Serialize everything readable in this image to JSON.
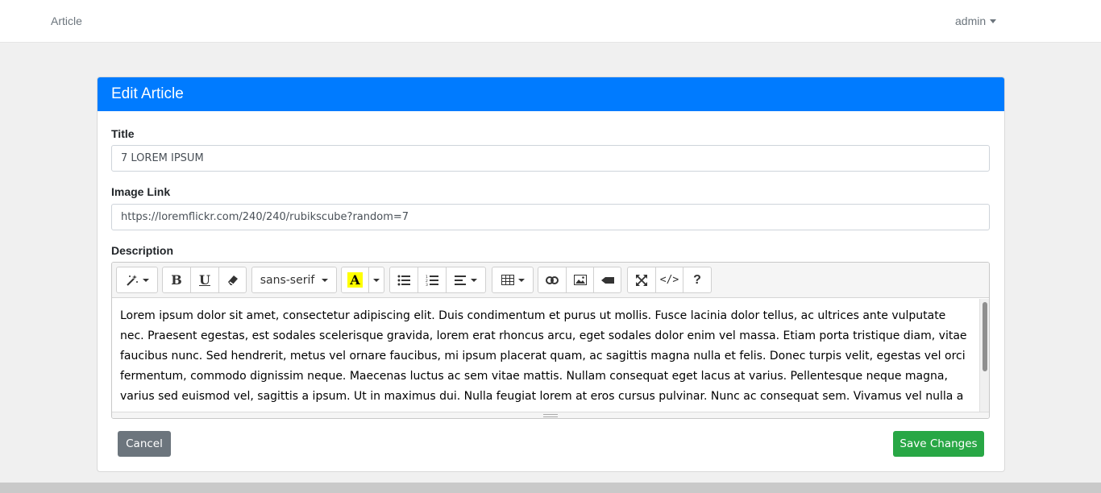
{
  "navbar": {
    "brand": "Article",
    "user": "admin"
  },
  "card": {
    "header": "Edit Article",
    "title_label": "Title",
    "title_value": "7 LOREM IPSUM",
    "image_label": "Image Link",
    "image_value": "https://loremflickr.com/240/240/rubikscube?random=7",
    "description_label": "Description"
  },
  "editor": {
    "font_name": "sans-serif",
    "highlight_color": "#ffff00",
    "toolbar_icons": [
      "magic-icon",
      "bold-icon",
      "underline-icon",
      "eraser-icon",
      "font-color-icon",
      "unordered-list-icon",
      "ordered-list-icon",
      "align-icon",
      "table-icon",
      "link-icon",
      "picture-icon",
      "video-icon",
      "fullscreen-icon",
      "code-view-icon",
      "help-icon"
    ],
    "body_text": "Lorem ipsum dolor sit amet, consectetur adipiscing elit. Duis condimentum et purus ut mollis. Fusce lacinia dolor tellus, ac ultrices ante vulputate nec. Praesent egestas, est sodales scelerisque gravida, lorem erat rhoncus arcu, eget sodales dolor enim vel massa. Etiam porta tristique diam, vitae faucibus nunc. Sed hendrerit, metus vel ornare faucibus, mi ipsum placerat quam, ac sagittis magna nulla et felis. Donec turpis velit, egestas vel orci fermentum, commodo dignissim neque. Maecenas luctus ac sem vitae mattis. Nullam consequat eget lacus at varius. Pellentesque neque magna, varius sed euismod vel, sagittis a ipsum. Ut in maximus dui. Nulla feugiat lorem at eros cursus pulvinar. Nunc ac consequat sem. Vivamus vel nulla a"
  },
  "actions": {
    "cancel": "Cancel",
    "save": "Save Changes"
  },
  "colors": {
    "header": "#007bff",
    "cancel": "#6c757d",
    "save": "#28a745"
  }
}
